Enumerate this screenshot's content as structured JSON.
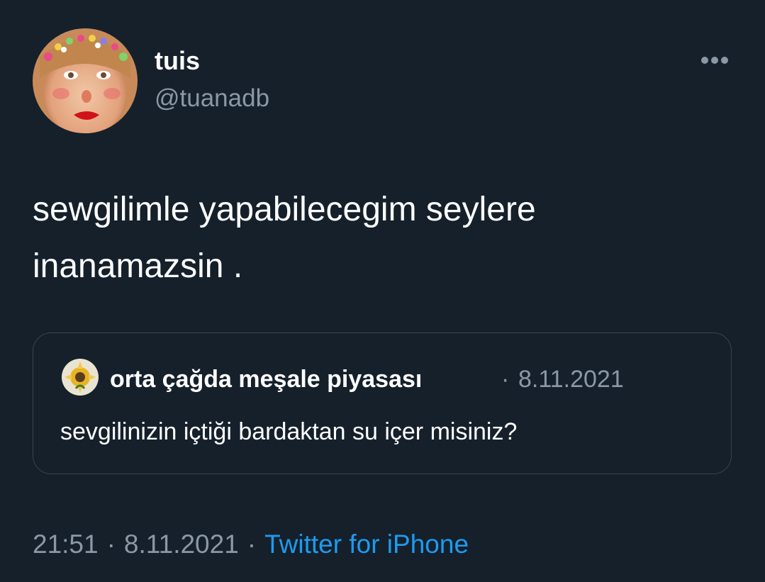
{
  "author": {
    "display_name": "tuis",
    "handle": "@tuanadb"
  },
  "menu": {
    "icon": "more-horizontal-icon"
  },
  "tweet": {
    "text": "sewgilimle yapabilecegim seylere\ninanamazsin ."
  },
  "quoted_tweet": {
    "author_name": "orta çağda meşale piyasası",
    "separator": "·",
    "date": "8.11.2021",
    "text": "sevgilinizin içtiği bardaktan su içer misiniz?"
  },
  "meta": {
    "time": "21:51",
    "separator": "·",
    "date": "8.11.2021",
    "source": "Twitter for iPhone"
  },
  "colors": {
    "background": "#15202b",
    "primary_text": "#ffffff",
    "secondary_text": "#8b98a5",
    "accent": "#1d9bf0",
    "border": "#38444d"
  }
}
